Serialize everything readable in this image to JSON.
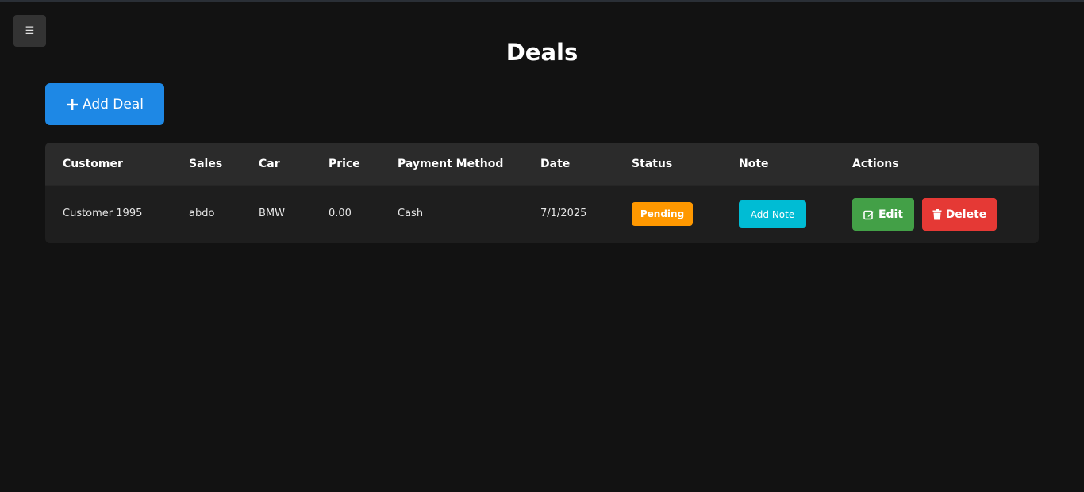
{
  "header": {
    "menu_icon": "☰",
    "title": "Deals"
  },
  "toolbar": {
    "add_icon": "plus-icon",
    "add_label": "Add Deal"
  },
  "table": {
    "columns": [
      "Customer",
      "Sales",
      "Car",
      "Price",
      "Payment Method",
      "Date",
      "Status",
      "Note",
      "Actions"
    ],
    "rows": [
      {
        "customer": "Customer 1995",
        "sales": "abdo",
        "car": "BMW",
        "price": "0.00",
        "payment_method": "Cash",
        "date": "7/1/2025",
        "status": "Pending",
        "note_label": "Add Note",
        "edit_label": "Edit",
        "delete_label": "Delete"
      }
    ]
  },
  "colors": {
    "background": "#121212",
    "primary": "#1e88e5",
    "pending": "#ff9800",
    "note": "#00bcd4",
    "edit": "#43a047",
    "delete": "#e53935"
  },
  "icons": {
    "menu": "menu-icon",
    "edit": "edit-icon",
    "delete": "trash-icon"
  }
}
